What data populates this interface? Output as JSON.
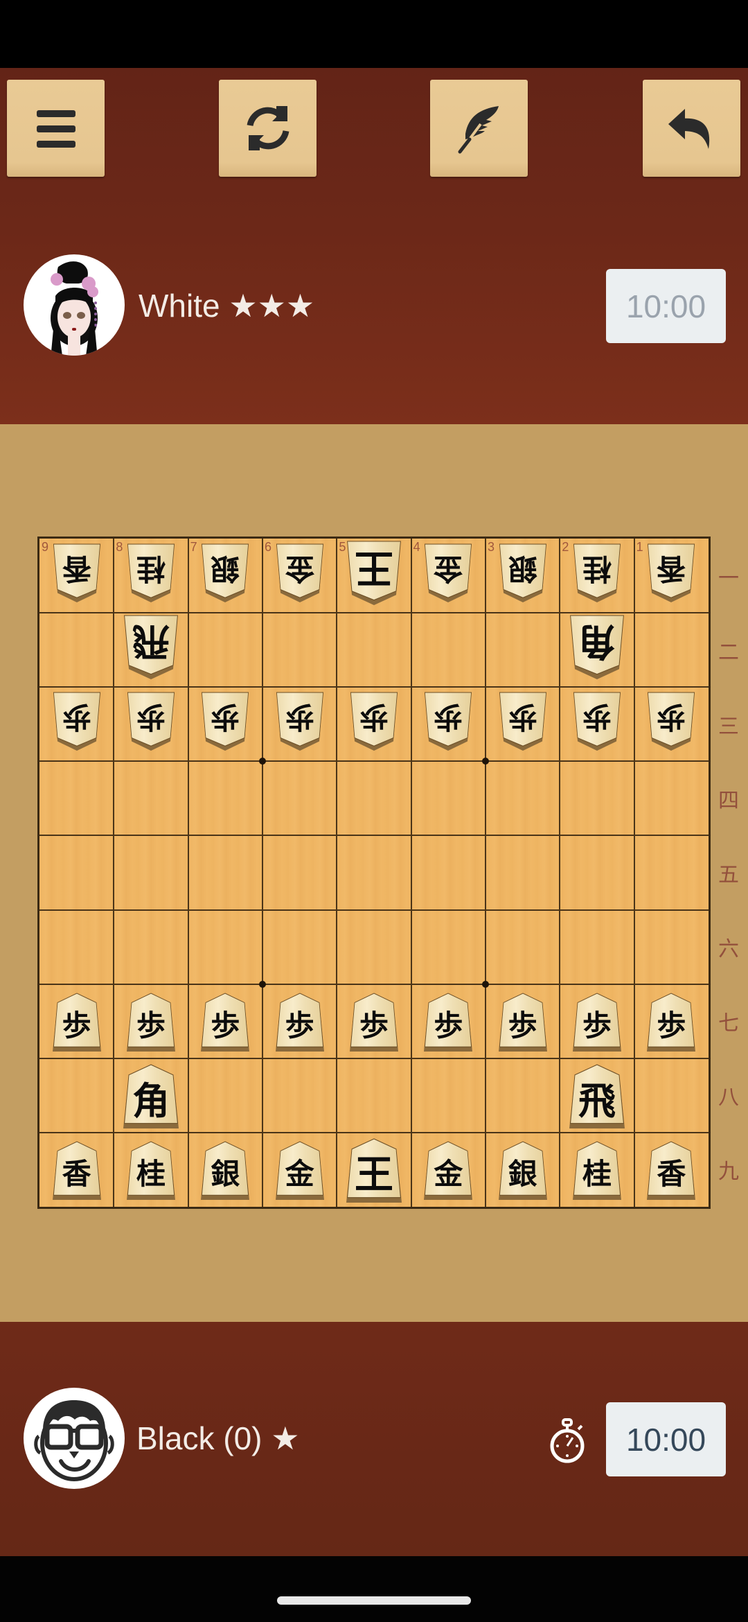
{
  "toolbar": {
    "buttons": [
      {
        "id": "menu",
        "icon": "hamburger-menu-icon"
      },
      {
        "id": "flip",
        "icon": "refresh-icon"
      },
      {
        "id": "record",
        "icon": "feather-icon"
      },
      {
        "id": "undo",
        "icon": "undo-arrow-icon"
      }
    ]
  },
  "players": {
    "white": {
      "name": "White ★★★",
      "clock": "10:00",
      "avatar": "geisha-avatar",
      "active": false
    },
    "black": {
      "name": "Black (0) ★",
      "clock": "10:00",
      "avatar": "glasses-guy-avatar",
      "active": true,
      "timer_icon": "stopwatch-icon"
    }
  },
  "board": {
    "files": [
      "9",
      "8",
      "7",
      "6",
      "5",
      "4",
      "3",
      "2",
      "1"
    ],
    "ranks": [
      "一",
      "二",
      "三",
      "四",
      "五",
      "六",
      "七",
      "八",
      "九"
    ],
    "colors": {
      "board": "#f0b765",
      "surround": "#c39e62",
      "panel": "#6a2818",
      "piece": "#f3e2b0"
    },
    "pieces": [
      {
        "file": 9,
        "rank": 1,
        "kanji": "香",
        "owner": "white"
      },
      {
        "file": 8,
        "rank": 1,
        "kanji": "桂",
        "owner": "white"
      },
      {
        "file": 7,
        "rank": 1,
        "kanji": "銀",
        "owner": "white"
      },
      {
        "file": 6,
        "rank": 1,
        "kanji": "金",
        "owner": "white"
      },
      {
        "file": 5,
        "rank": 1,
        "kanji": "王",
        "owner": "white",
        "king": true
      },
      {
        "file": 4,
        "rank": 1,
        "kanji": "金",
        "owner": "white"
      },
      {
        "file": 3,
        "rank": 1,
        "kanji": "銀",
        "owner": "white"
      },
      {
        "file": 2,
        "rank": 1,
        "kanji": "桂",
        "owner": "white"
      },
      {
        "file": 1,
        "rank": 1,
        "kanji": "香",
        "owner": "white"
      },
      {
        "file": 8,
        "rank": 2,
        "kanji": "飛",
        "owner": "white",
        "major": true
      },
      {
        "file": 2,
        "rank": 2,
        "kanji": "角",
        "owner": "white",
        "major": true
      },
      {
        "file": 9,
        "rank": 3,
        "kanji": "歩",
        "owner": "white"
      },
      {
        "file": 8,
        "rank": 3,
        "kanji": "歩",
        "owner": "white"
      },
      {
        "file": 7,
        "rank": 3,
        "kanji": "歩",
        "owner": "white"
      },
      {
        "file": 6,
        "rank": 3,
        "kanji": "歩",
        "owner": "white"
      },
      {
        "file": 5,
        "rank": 3,
        "kanji": "歩",
        "owner": "white"
      },
      {
        "file": 4,
        "rank": 3,
        "kanji": "歩",
        "owner": "white"
      },
      {
        "file": 3,
        "rank": 3,
        "kanji": "歩",
        "owner": "white"
      },
      {
        "file": 2,
        "rank": 3,
        "kanji": "歩",
        "owner": "white"
      },
      {
        "file": 1,
        "rank": 3,
        "kanji": "歩",
        "owner": "white"
      },
      {
        "file": 9,
        "rank": 7,
        "kanji": "歩",
        "owner": "black"
      },
      {
        "file": 8,
        "rank": 7,
        "kanji": "歩",
        "owner": "black"
      },
      {
        "file": 7,
        "rank": 7,
        "kanji": "歩",
        "owner": "black"
      },
      {
        "file": 6,
        "rank": 7,
        "kanji": "歩",
        "owner": "black"
      },
      {
        "file": 5,
        "rank": 7,
        "kanji": "歩",
        "owner": "black"
      },
      {
        "file": 4,
        "rank": 7,
        "kanji": "歩",
        "owner": "black"
      },
      {
        "file": 3,
        "rank": 7,
        "kanji": "歩",
        "owner": "black"
      },
      {
        "file": 2,
        "rank": 7,
        "kanji": "歩",
        "owner": "black"
      },
      {
        "file": 1,
        "rank": 7,
        "kanji": "歩",
        "owner": "black"
      },
      {
        "file": 8,
        "rank": 8,
        "kanji": "角",
        "owner": "black",
        "major": true
      },
      {
        "file": 2,
        "rank": 8,
        "kanji": "飛",
        "owner": "black",
        "major": true
      },
      {
        "file": 9,
        "rank": 9,
        "kanji": "香",
        "owner": "black"
      },
      {
        "file": 8,
        "rank": 9,
        "kanji": "桂",
        "owner": "black"
      },
      {
        "file": 7,
        "rank": 9,
        "kanji": "銀",
        "owner": "black"
      },
      {
        "file": 6,
        "rank": 9,
        "kanji": "金",
        "owner": "black"
      },
      {
        "file": 5,
        "rank": 9,
        "kanji": "王",
        "owner": "black",
        "king": true
      },
      {
        "file": 4,
        "rank": 9,
        "kanji": "金",
        "owner": "black"
      },
      {
        "file": 3,
        "rank": 9,
        "kanji": "銀",
        "owner": "black"
      },
      {
        "file": 2,
        "rank": 9,
        "kanji": "桂",
        "owner": "black"
      },
      {
        "file": 1,
        "rank": 9,
        "kanji": "香",
        "owner": "black"
      }
    ]
  }
}
